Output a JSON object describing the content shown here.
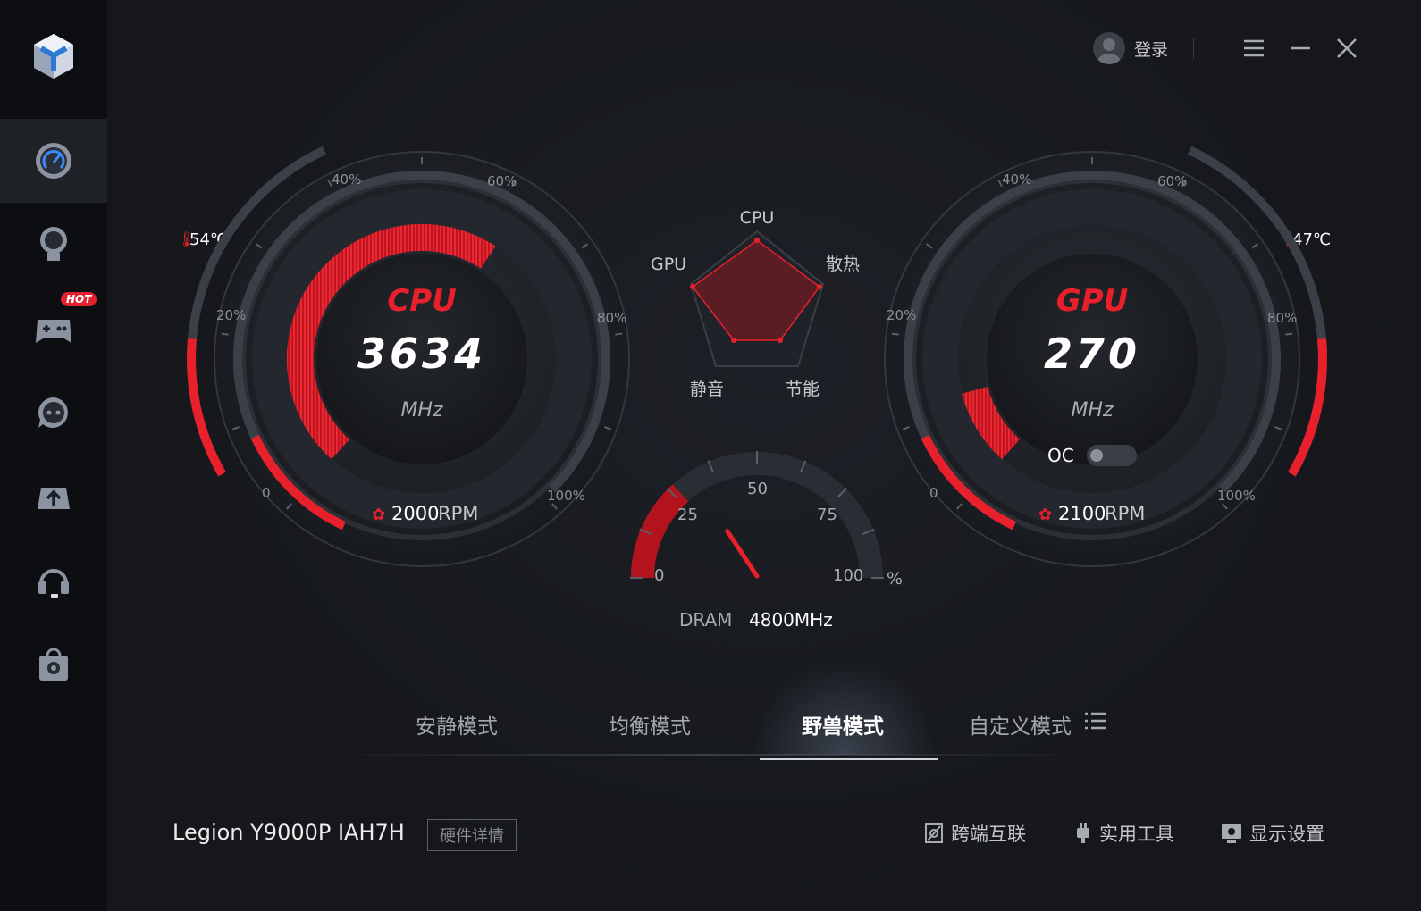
{
  "topbar": {
    "login_label": "登录"
  },
  "sidebar": {
    "hot_badge": "HOT"
  },
  "cpu_gauge": {
    "title": "CPU",
    "value": "3634",
    "unit": "MHz",
    "temperature": "54℃",
    "fan_rpm": "2000",
    "fan_unit": "RPM",
    "scale_labels": [
      "0",
      "20%",
      "40%",
      "60%",
      "80%",
      "100%"
    ],
    "load_fraction": 0.62,
    "accent_color": "#e8202c"
  },
  "gpu_gauge": {
    "title": "GPU",
    "value": "270",
    "unit": "MHz",
    "temperature": "47℃",
    "fan_rpm": "2100",
    "fan_unit": "RPM",
    "oc_label": "OC",
    "oc_enabled": false,
    "scale_labels": [
      "0",
      "20%",
      "40%",
      "60%",
      "80%",
      "100%"
    ],
    "load_fraction": 0.12
  },
  "radar": {
    "labels": {
      "top": "CPU",
      "right": "散热",
      "bottom_right": "节能",
      "bottom_left": "静音",
      "left": "GPU"
    }
  },
  "dram_gauge": {
    "scale_labels": [
      "0",
      "25",
      "50",
      "75",
      "100"
    ],
    "percent_sign": "%",
    "label": "DRAM",
    "value": "4800MHz",
    "usage_percent": 20
  },
  "modes": {
    "items": [
      "安静模式",
      "均衡模式",
      "野兽模式",
      "自定义模式"
    ],
    "active": "野兽模式"
  },
  "footer": {
    "device_name": "Legion Y9000P IAH7H",
    "hw_details_label": "硬件详情",
    "links": [
      "跨端互联",
      "实用工具",
      "显示设置"
    ]
  }
}
